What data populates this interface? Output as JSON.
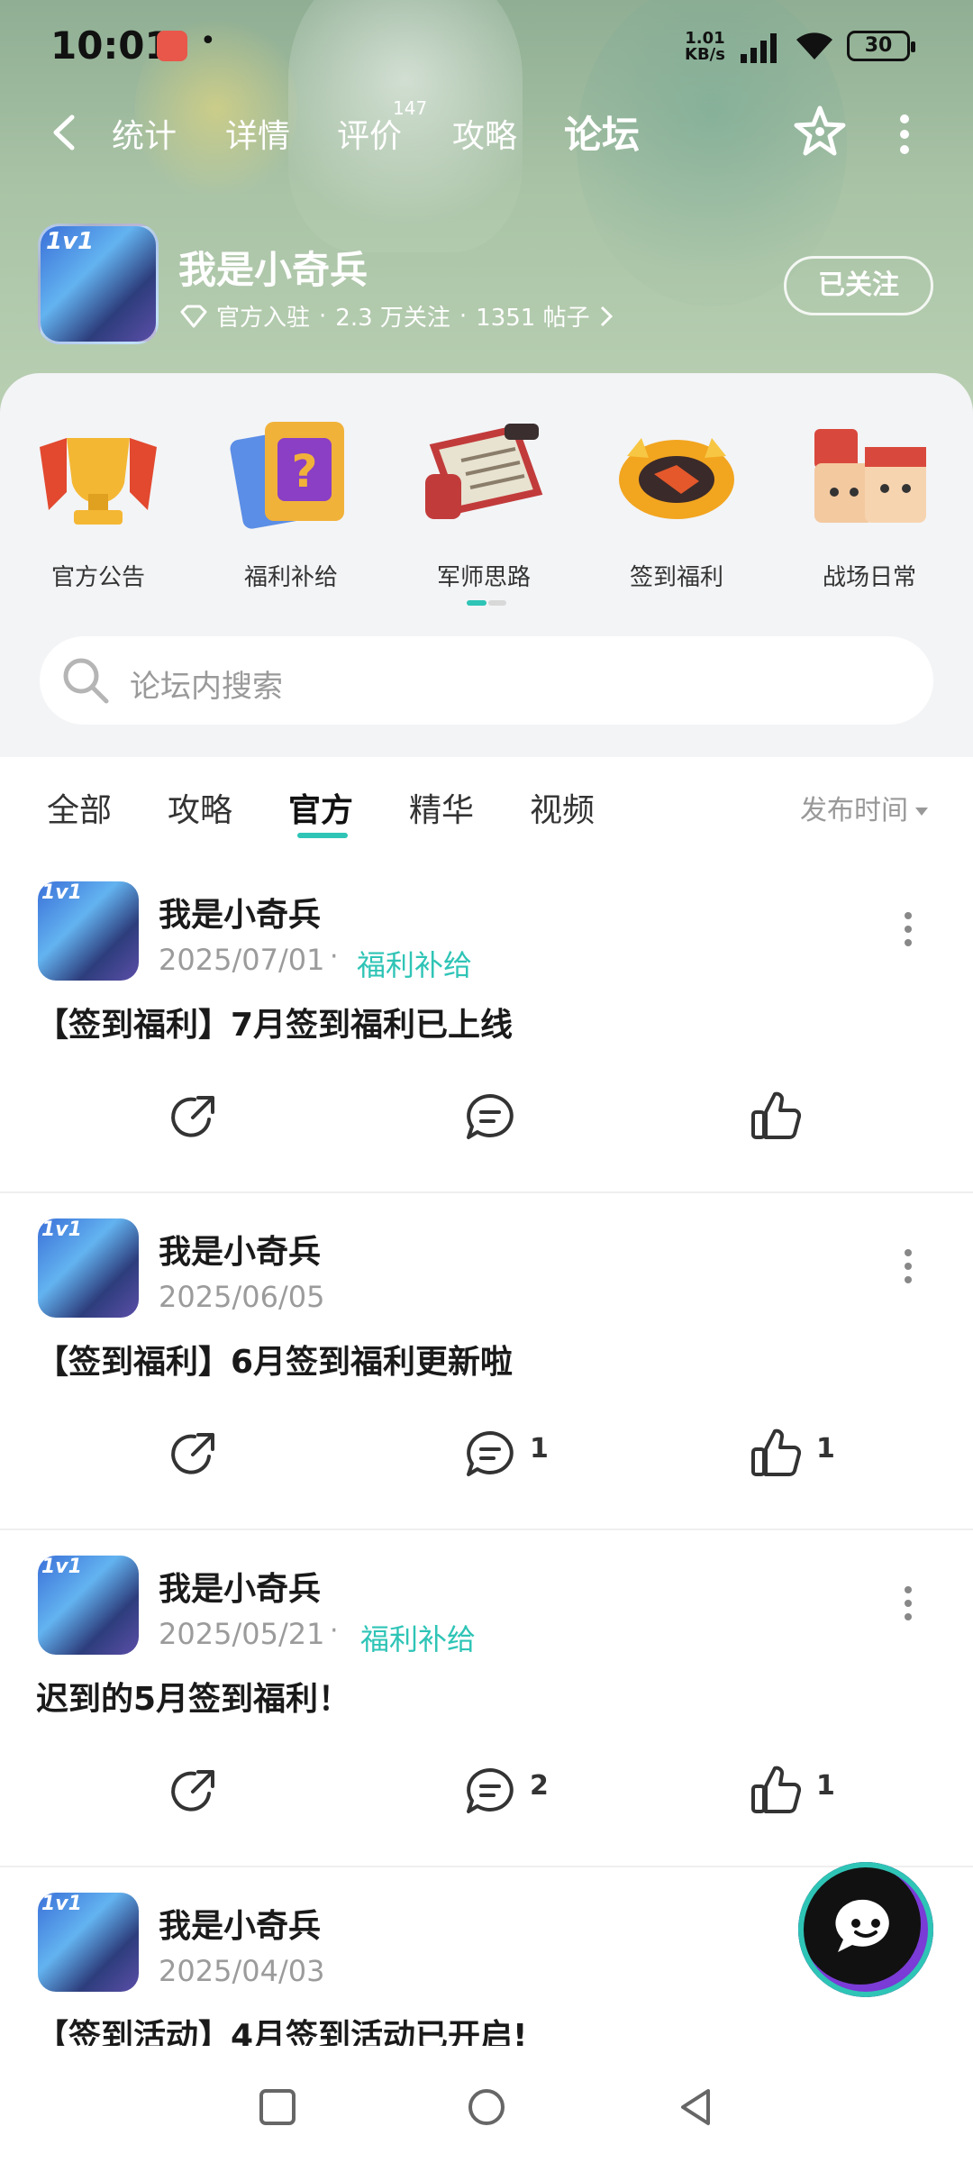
{
  "statusbar": {
    "time": "10:01",
    "net_speed_top": "1.01",
    "net_speed_unit": "KB/s",
    "battery": "30"
  },
  "topnav": {
    "tabs": [
      {
        "label": "统计"
      },
      {
        "label": "详情"
      },
      {
        "label": "评价",
        "badge": "147"
      },
      {
        "label": "攻略"
      },
      {
        "label": "论坛",
        "active": true
      }
    ]
  },
  "game": {
    "name": "我是小奇兵",
    "icon_badge": "1v1",
    "meta_official": "官方入驻",
    "meta_sep": "·",
    "meta_follows": "2.3 万关注",
    "meta_posts": "1351 帖子",
    "follow_label": "已关注"
  },
  "categories": [
    {
      "label": "官方公告",
      "icon": "trophy-icon"
    },
    {
      "label": "福利补给",
      "icon": "gift-card-icon"
    },
    {
      "label": "军师思路",
      "icon": "scroll-icon"
    },
    {
      "label": "签到福利",
      "icon": "gold-wreath-icon"
    },
    {
      "label": "战场日常",
      "icon": "characters-icon"
    }
  ],
  "search": {
    "placeholder": "论坛内搜索"
  },
  "filters": {
    "tabs": [
      {
        "label": "全部"
      },
      {
        "label": "攻略"
      },
      {
        "label": "官方",
        "active": true
      },
      {
        "label": "精华"
      },
      {
        "label": "视频"
      }
    ],
    "sort_label": "发布时间"
  },
  "posts": [
    {
      "author": "我是小奇兵",
      "date": "2025/07/01",
      "tag": "福利补给",
      "title": "【签到福利】7月签到福利已上线",
      "comments": "",
      "likes": ""
    },
    {
      "author": "我是小奇兵",
      "date": "2025/06/05",
      "tag": "",
      "title": "【签到福利】6月签到福利更新啦",
      "comments": "1",
      "likes": "1"
    },
    {
      "author": "我是小奇兵",
      "date": "2025/05/21",
      "tag": "福利补给",
      "title": "迟到的5月签到福利！",
      "comments": "2",
      "likes": "1"
    },
    {
      "author": "我是小奇兵",
      "date": "2025/04/03",
      "tag": "",
      "title": "【签到活动】4月签到活动已开启!",
      "comments": "",
      "likes": ""
    }
  ],
  "colors": {
    "accent": "#2ec4b6",
    "header_bg": "#a9c3a6",
    "panel_bg": "#f3f4f6"
  }
}
